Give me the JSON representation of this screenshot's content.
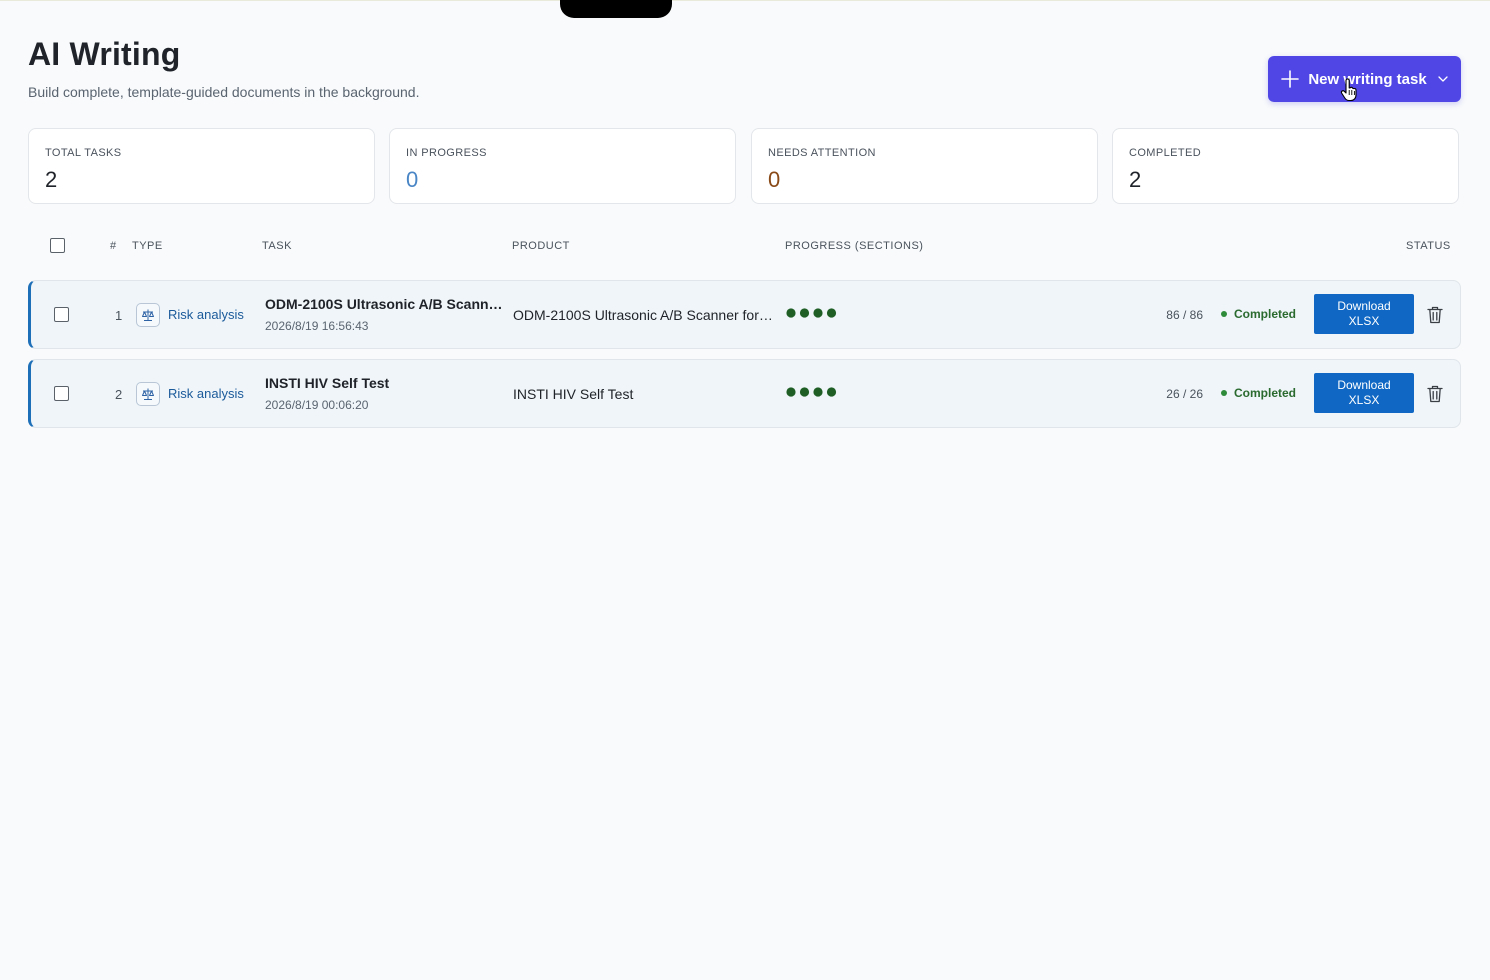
{
  "header": {
    "title": "AI Writing",
    "subtitle": "Build complete, template-guided documents in the background.",
    "new_task_label": "New writing task",
    "new_task_icon": "plus-icon",
    "new_task_caret": "chevron-down-icon"
  },
  "stats": [
    {
      "label": "TOTAL TASKS",
      "value": "2"
    },
    {
      "label": "IN PROGRESS",
      "value": "0"
    },
    {
      "label": "NEEDS ATTENTION",
      "value": "0"
    },
    {
      "label": "COMPLETED",
      "value": "2"
    }
  ],
  "table": {
    "columns": {
      "num": "#",
      "type": "TYPE",
      "task": "TASK",
      "product": "PRODUCT",
      "progress": "PROGRESS (SECTIONS)",
      "status": "STATUS"
    },
    "rows": [
      {
        "num": "1",
        "type": "Risk analysis",
        "type_icon": "scale-icon",
        "task": "ODM-2100S Ultrasonic A/B Scanner f...",
        "time": "2026/8/19 16:56:43",
        "product": "ODM-2100S Ultrasonic A/B Scanner for O...",
        "progress_dots": 4,
        "count": "86 / 86",
        "status": "Completed",
        "download_line1": "Download",
        "download_line2": "XLSX"
      },
      {
        "num": "2",
        "type": "Risk analysis",
        "type_icon": "scale-icon",
        "task": "INSTI HIV Self Test",
        "time": "2026/8/19 00:06:20",
        "product": "INSTI HIV Self Test",
        "progress_dots": 4,
        "count": "26 / 26",
        "status": "Completed",
        "download_line1": "Download",
        "download_line2": "XLSX"
      }
    ]
  },
  "colors": {
    "accent": "#4f46e5",
    "download": "#1168c4",
    "completed": "#2e8b3a",
    "progress_dot": "#1f5f25"
  }
}
